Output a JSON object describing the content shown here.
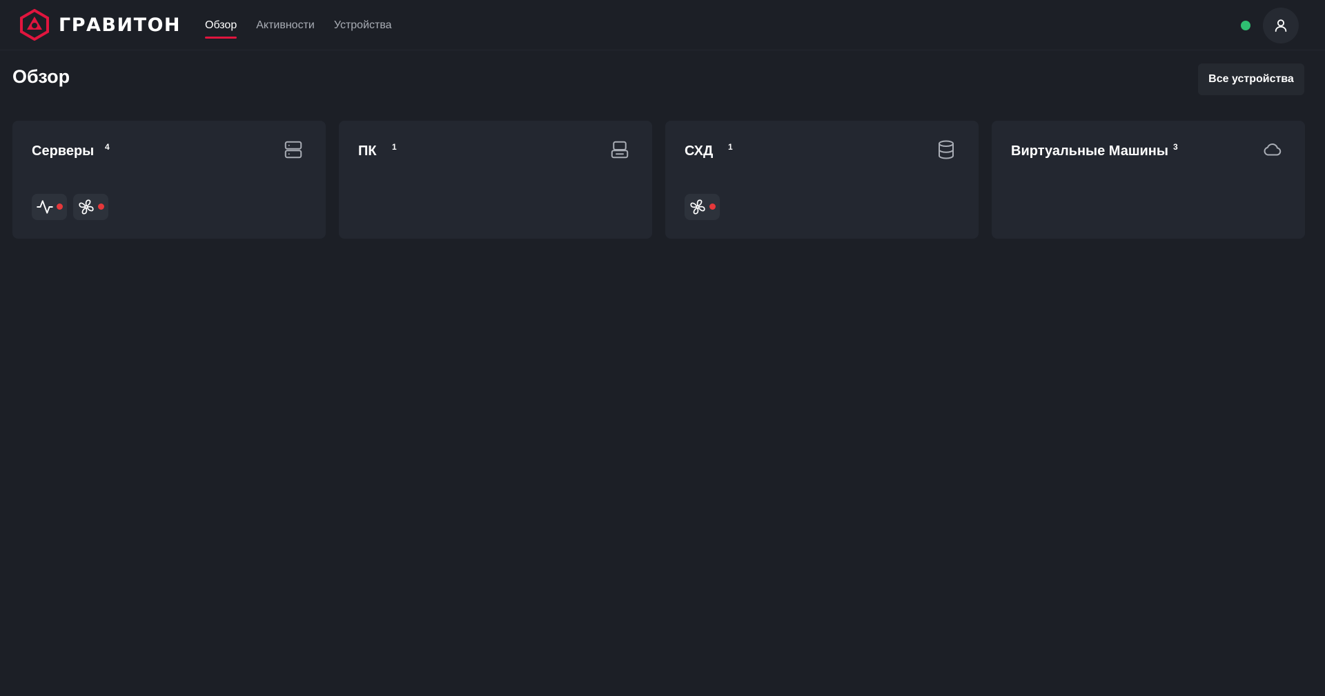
{
  "brand": {
    "name": "ГРАВИТОН",
    "accent_color": "#e0153e"
  },
  "nav": {
    "items": [
      {
        "label": "Обзор",
        "active": true
      },
      {
        "label": "Активности",
        "active": false
      },
      {
        "label": "Устройства",
        "active": false
      }
    ]
  },
  "header": {
    "status_color": "#2fbf71",
    "user_icon": "user-icon"
  },
  "page": {
    "title": "Обзор",
    "all_devices_label": "Все устройства"
  },
  "cards": [
    {
      "title": "Серверы",
      "count": "4",
      "icon": "server-icon",
      "alerts": [
        "activity-icon",
        "fan-icon"
      ]
    },
    {
      "title": "ПК",
      "count": "1",
      "icon": "desktop-icon",
      "alerts": []
    },
    {
      "title": "СХД",
      "count": "1",
      "icon": "database-icon",
      "alerts": [
        "fan-icon"
      ]
    },
    {
      "title": "Виртуальные Машины",
      "count": "3",
      "icon": "cloud-icon",
      "alerts": []
    }
  ],
  "alert_color": "#e5383b"
}
